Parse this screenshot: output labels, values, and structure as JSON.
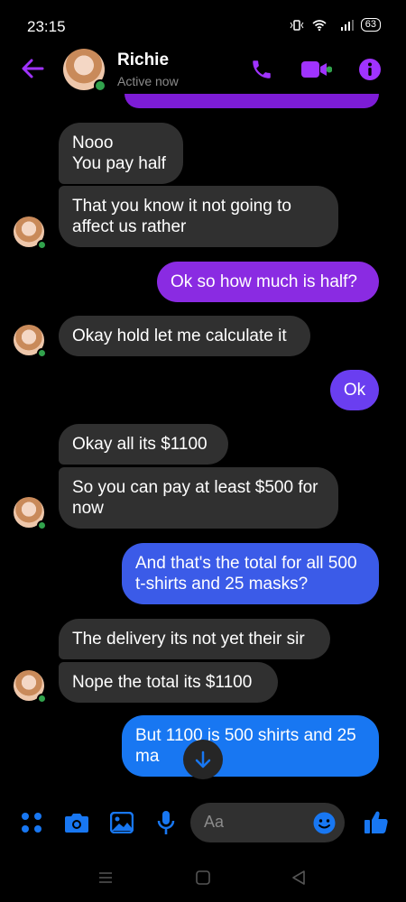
{
  "status_bar": {
    "time": "23:15",
    "battery": "63"
  },
  "header": {
    "name": "Richie",
    "status": "Active now"
  },
  "messages": [
    {
      "text": "Nooo\nYou pay half",
      "from": "them"
    },
    {
      "text": "That you know it not going to affect us rather",
      "from": "them"
    },
    {
      "text": "Ok so how much is half?",
      "from": "me"
    },
    {
      "text": "Okay hold let me calculate it",
      "from": "them"
    },
    {
      "text": "Ok",
      "from": "me"
    },
    {
      "text": "Okay all its $1100",
      "from": "them"
    },
    {
      "text": "So you can pay at least $500 for now",
      "from": "them"
    },
    {
      "text": "And that's the total for all 500 t-shirts and 25 masks?",
      "from": "me"
    },
    {
      "text": "The delivery its not yet their sir",
      "from": "them"
    },
    {
      "text": "Nope the total its $1100",
      "from": "them"
    },
    {
      "text": "But 1100 is 500 shirts and 25 ma",
      "from": "me"
    }
  ],
  "composer": {
    "placeholder": "Aa"
  },
  "colors": {
    "accent": "#a033ff",
    "incoming": "#303030",
    "online": "#31a24c",
    "outgoing_purple": "#8a2be2",
    "outgoing_blue": "#1877f2"
  },
  "icons": [
    "back-arrow-icon",
    "phone-icon",
    "video-icon",
    "info-icon",
    "menu-dots-icon",
    "camera-icon",
    "gallery-icon",
    "microphone-icon",
    "emoji-icon",
    "like-icon",
    "scroll-down-icon"
  ]
}
